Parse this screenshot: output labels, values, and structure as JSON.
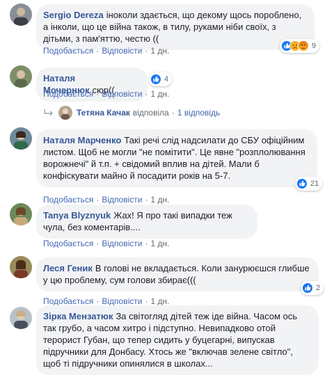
{
  "actions": {
    "like": "Подобається",
    "reply": "Відповісти",
    "dot": "·"
  },
  "comments": [
    {
      "author": "Sergio Dereza",
      "text": "іноколи здається, що декому щось пороблено, а інколи, що це війна також, в тилу, руками ніби своїх, з дітьми, з пам'яттю, честю ((",
      "time": "1 дн.",
      "reaction_count": "9",
      "reaction_icons": [
        "like-icon",
        "sad-icon",
        "angry-icon"
      ]
    },
    {
      "author": "Наталя Мочернюк",
      "text": "сюр((",
      "time": "1 дн.",
      "reaction_count": "4",
      "reaction_icons": [
        "like-icon"
      ],
      "reply": {
        "author": "Тетяна Качак",
        "action": "відповіла",
        "count": "1 відповідь"
      }
    },
    {
      "author": "Наталя Марченко",
      "text": "Такі речі слід надсилати до СБУ офіційним листом. Щоб не могли \"не помітити\". Це явне \"розплолювання ворожнечі\" й т.п. + свідомий вплив на дітей. Мали б конфіскувати майно й посадити років на 5-7.",
      "time": "1 дн.",
      "reaction_count": "21",
      "reaction_icons": [
        "like-icon"
      ]
    },
    {
      "author": "Tanya Blyznyuk",
      "text": "Жах! Я про такі випадки теж чула, без коментарів....",
      "time": "1 дн.",
      "reaction_count": "",
      "reaction_icons": []
    },
    {
      "author": "Леся Геник",
      "text": "В голові не вкладається. Коли занурюєшся глибше у цю проблему, сум голови збирає(((",
      "time": "1 дн.",
      "reaction_count": "2",
      "reaction_icons": [
        "like-icon"
      ]
    },
    {
      "author": "Зірка Мензатюк",
      "text": "За світогляд дітей теж іде війна. Часом ось так грубо, а часом хитро і підступно. Невипадково отой терорист Губан, що тепер сидить у буцегарні, випускав підручники для Донбасу. Хтось же \"включав зелене світло\", щоб ті підручники опинялися в школах...",
      "time": "",
      "reaction_count": "",
      "reaction_icons": []
    }
  ],
  "colors": {
    "like": "#1877f2",
    "sad": "#f7b125",
    "angry": "#e9710f",
    "link": "#385898"
  }
}
